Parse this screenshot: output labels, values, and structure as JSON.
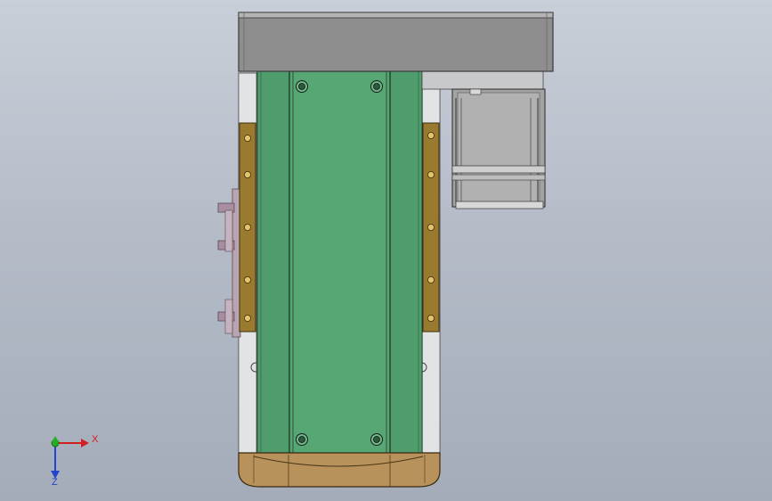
{
  "viewport": {
    "background": [
      "#c9cfd8",
      "#a4acba"
    ]
  },
  "model": {
    "colors": {
      "top_plate": "#8e8e8e",
      "top_plate_edge": "#5a5a5a",
      "carriage": "#56a774",
      "carriage_dark": "#4a9465",
      "rail_bar": "#9a7a2e",
      "frame_aluminum": "#d4d6d8",
      "motor_body": "#a3a3a3",
      "end_cap": "#b8925a",
      "clamp_accent": "#8a6f80"
    }
  },
  "triad": {
    "x_label": "X",
    "z_label": "Z",
    "x_color": "#d21f1f",
    "y_color": "#22b022",
    "z_color": "#2244cc"
  }
}
